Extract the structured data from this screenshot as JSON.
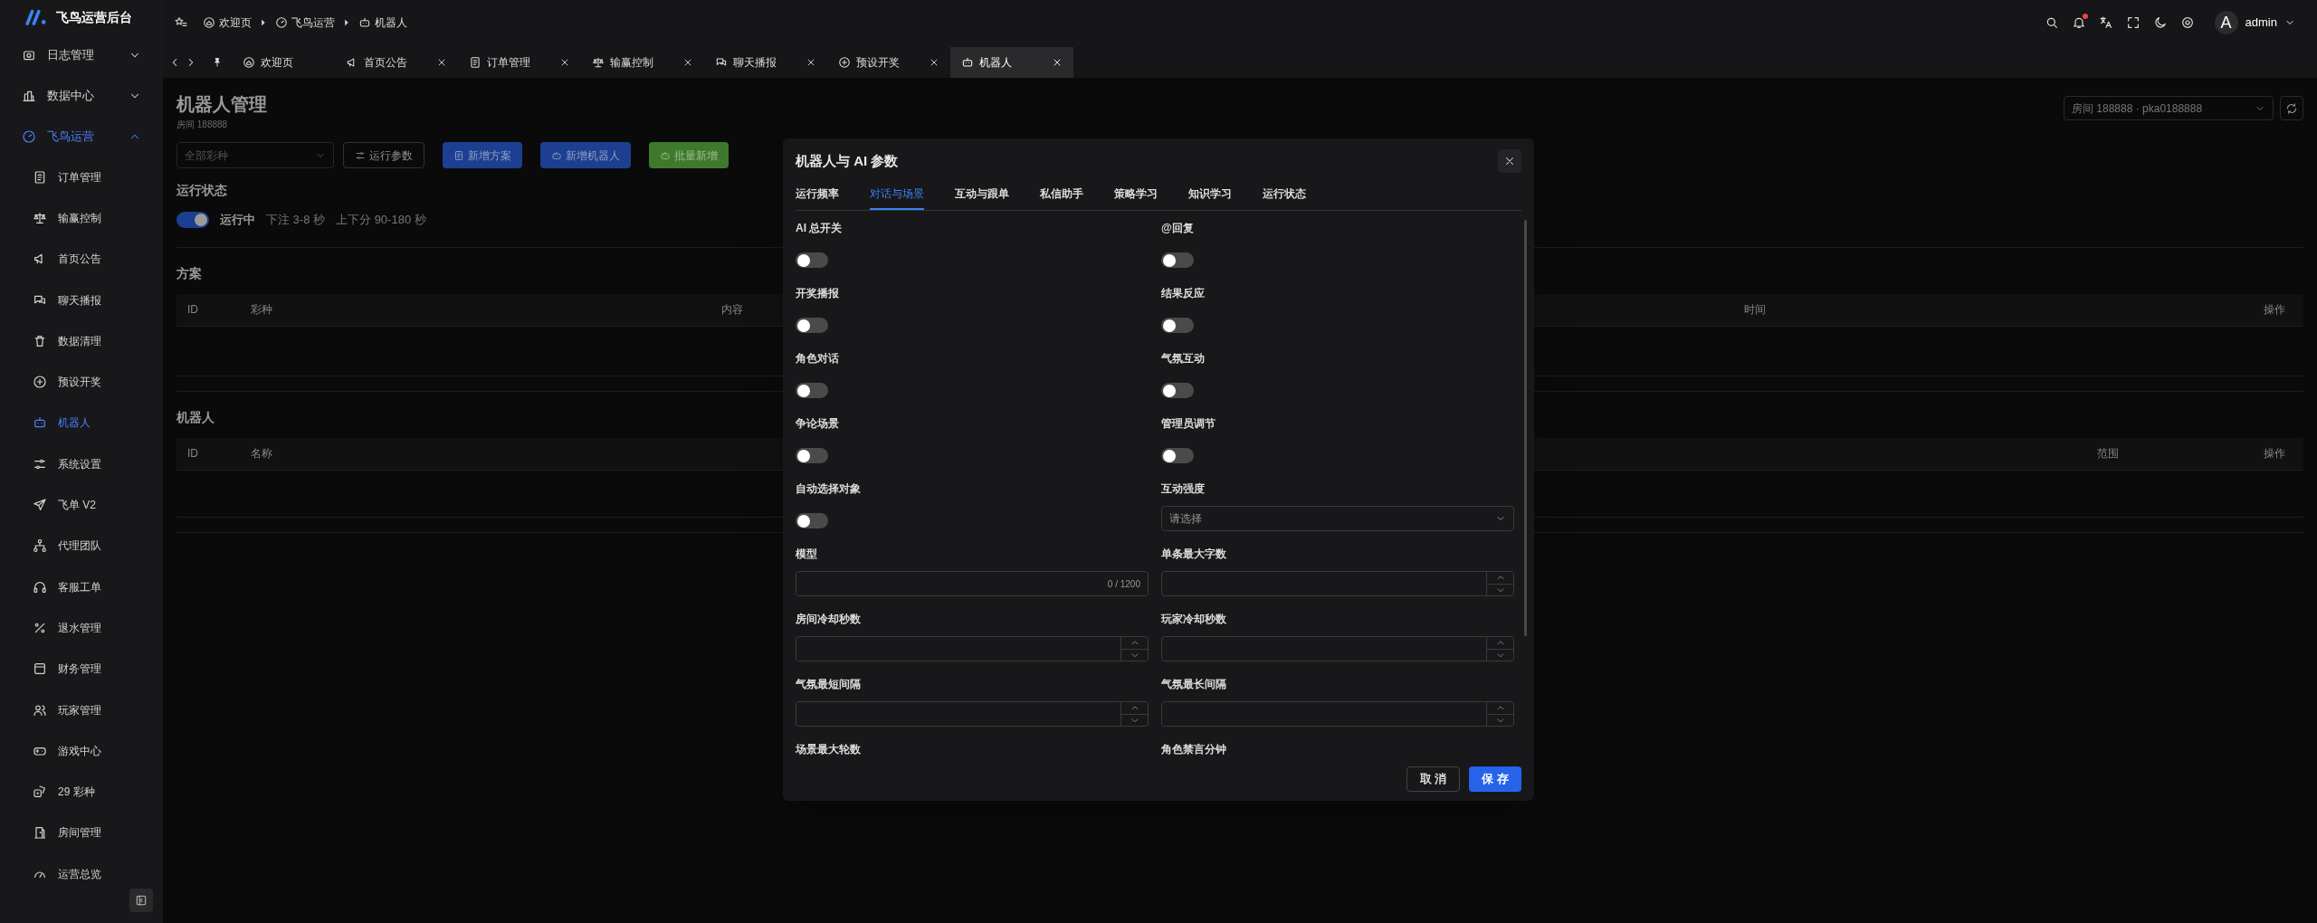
{
  "sidebar": {
    "title": "飞鸟运营后台",
    "items": [
      {
        "label": "日志管理",
        "selected": false,
        "expanded": false
      },
      {
        "label": "数据中心",
        "selected": false,
        "expanded": false
      },
      {
        "label": "飞鸟运营",
        "selected": true,
        "expanded": true,
        "children": [
          {
            "label": "订单管理",
            "selected": false
          },
          {
            "label": "输赢控制",
            "selected": false
          },
          {
            "label": "首页公告",
            "selected": false
          },
          {
            "label": "聊天播报",
            "selected": false
          },
          {
            "label": "数据清理",
            "selected": false
          },
          {
            "label": "预设开奖",
            "selected": false
          },
          {
            "label": "机器人",
            "selected": true
          },
          {
            "label": "系统设置",
            "selected": false
          },
          {
            "label": "飞单 V2",
            "selected": false
          },
          {
            "label": "代理团队",
            "selected": false
          },
          {
            "label": "客服工单",
            "selected": false
          },
          {
            "label": "退水管理",
            "selected": false
          },
          {
            "label": "财务管理",
            "selected": false
          },
          {
            "label": "玩家管理",
            "selected": false
          },
          {
            "label": "游戏中心",
            "selected": false
          },
          {
            "label": "29 彩种",
            "selected": false
          },
          {
            "label": "房间管理",
            "selected": false
          },
          {
            "label": "运营总览",
            "selected": false
          }
        ]
      }
    ]
  },
  "breadcrumb": [
    "欢迎页",
    "飞鸟运营",
    "机器人"
  ],
  "tabs": [
    {
      "label": "欢迎页",
      "selected": false,
      "pinned": true
    },
    {
      "label": "首页公告",
      "selected": false,
      "pinned": false
    },
    {
      "label": "订单管理",
      "selected": false,
      "pinned": false
    },
    {
      "label": "输赢控制",
      "selected": false,
      "pinned": false
    },
    {
      "label": "聊天播报",
      "selected": false,
      "pinned": false
    },
    {
      "label": "预设开奖",
      "selected": false,
      "pinned": false
    },
    {
      "label": "机器人",
      "selected": true,
      "pinned": false
    }
  ],
  "user": {
    "avatar": "A",
    "name": "admin"
  },
  "page": {
    "title": "机器人管理",
    "subtitle": "房间 188888",
    "room_select": "房间 188888 · pka0188888",
    "toolbar": {
      "filter_placeholder": "全部彩种",
      "buttons": [
        {
          "label": "运行参数",
          "kind": "outline"
        },
        {
          "label": "新增方案",
          "kind": "primary"
        },
        {
          "label": "新增机器人",
          "kind": "primary"
        },
        {
          "label": "批量新增",
          "kind": "success"
        }
      ]
    },
    "status": {
      "heading": "运行状态",
      "on": true,
      "label": "运行中",
      "details": [
        "下注 3-8 秒",
        "上下分 90-180 秒"
      ]
    },
    "plans": {
      "heading": "方案",
      "columns": [
        "ID",
        "彩种",
        "内容",
        "时间",
        "操作"
      ]
    },
    "robots": {
      "heading": "机器人",
      "columns": [
        "ID",
        "名称",
        "范围",
        "操作"
      ]
    }
  },
  "dialog": {
    "title": "机器人与 AI 参数",
    "tabs": [
      {
        "label": "运行频率",
        "selected": false
      },
      {
        "label": "对话与场景",
        "selected": true
      },
      {
        "label": "互动与跟单",
        "selected": false
      },
      {
        "label": "私信助手",
        "selected": false
      },
      {
        "label": "策略学习",
        "selected": false
      },
      {
        "label": "知识学习",
        "selected": false
      },
      {
        "label": "运行状态",
        "selected": false
      }
    ],
    "fields": [
      {
        "label": "AI 总开关",
        "kind": "toggle",
        "on": false
      },
      {
        "label": "@回复",
        "kind": "toggle",
        "on": false
      },
      {
        "label": "开奖播报",
        "kind": "toggle",
        "on": false
      },
      {
        "label": "结果反应",
        "kind": "toggle",
        "on": false
      },
      {
        "label": "角色对话",
        "kind": "toggle",
        "on": false
      },
      {
        "label": "气氛互动",
        "kind": "toggle",
        "on": false
      },
      {
        "label": "争论场景",
        "kind": "toggle",
        "on": false
      },
      {
        "label": "管理员调节",
        "kind": "toggle",
        "on": false
      },
      {
        "label": "自动选择对象",
        "kind": "toggle",
        "on": false
      },
      {
        "label": "互动强度",
        "kind": "select",
        "placeholder": "请选择"
      },
      {
        "label": "模型",
        "kind": "text",
        "counter": "0 / 1200"
      },
      {
        "label": "单条最大字数",
        "kind": "number"
      },
      {
        "label": "房间冷却秒数",
        "kind": "number"
      },
      {
        "label": "玩家冷却秒数",
        "kind": "number"
      },
      {
        "label": "气氛最短间隔",
        "kind": "number"
      },
      {
        "label": "气氛最长间隔",
        "kind": "number"
      },
      {
        "label": "场景最大轮数",
        "kind": "label"
      },
      {
        "label": "角色禁言分钟",
        "kind": "label"
      }
    ],
    "buttons": [
      {
        "label": "取 消",
        "kind": "default"
      },
      {
        "label": "保 存",
        "kind": "primary"
      }
    ]
  }
}
